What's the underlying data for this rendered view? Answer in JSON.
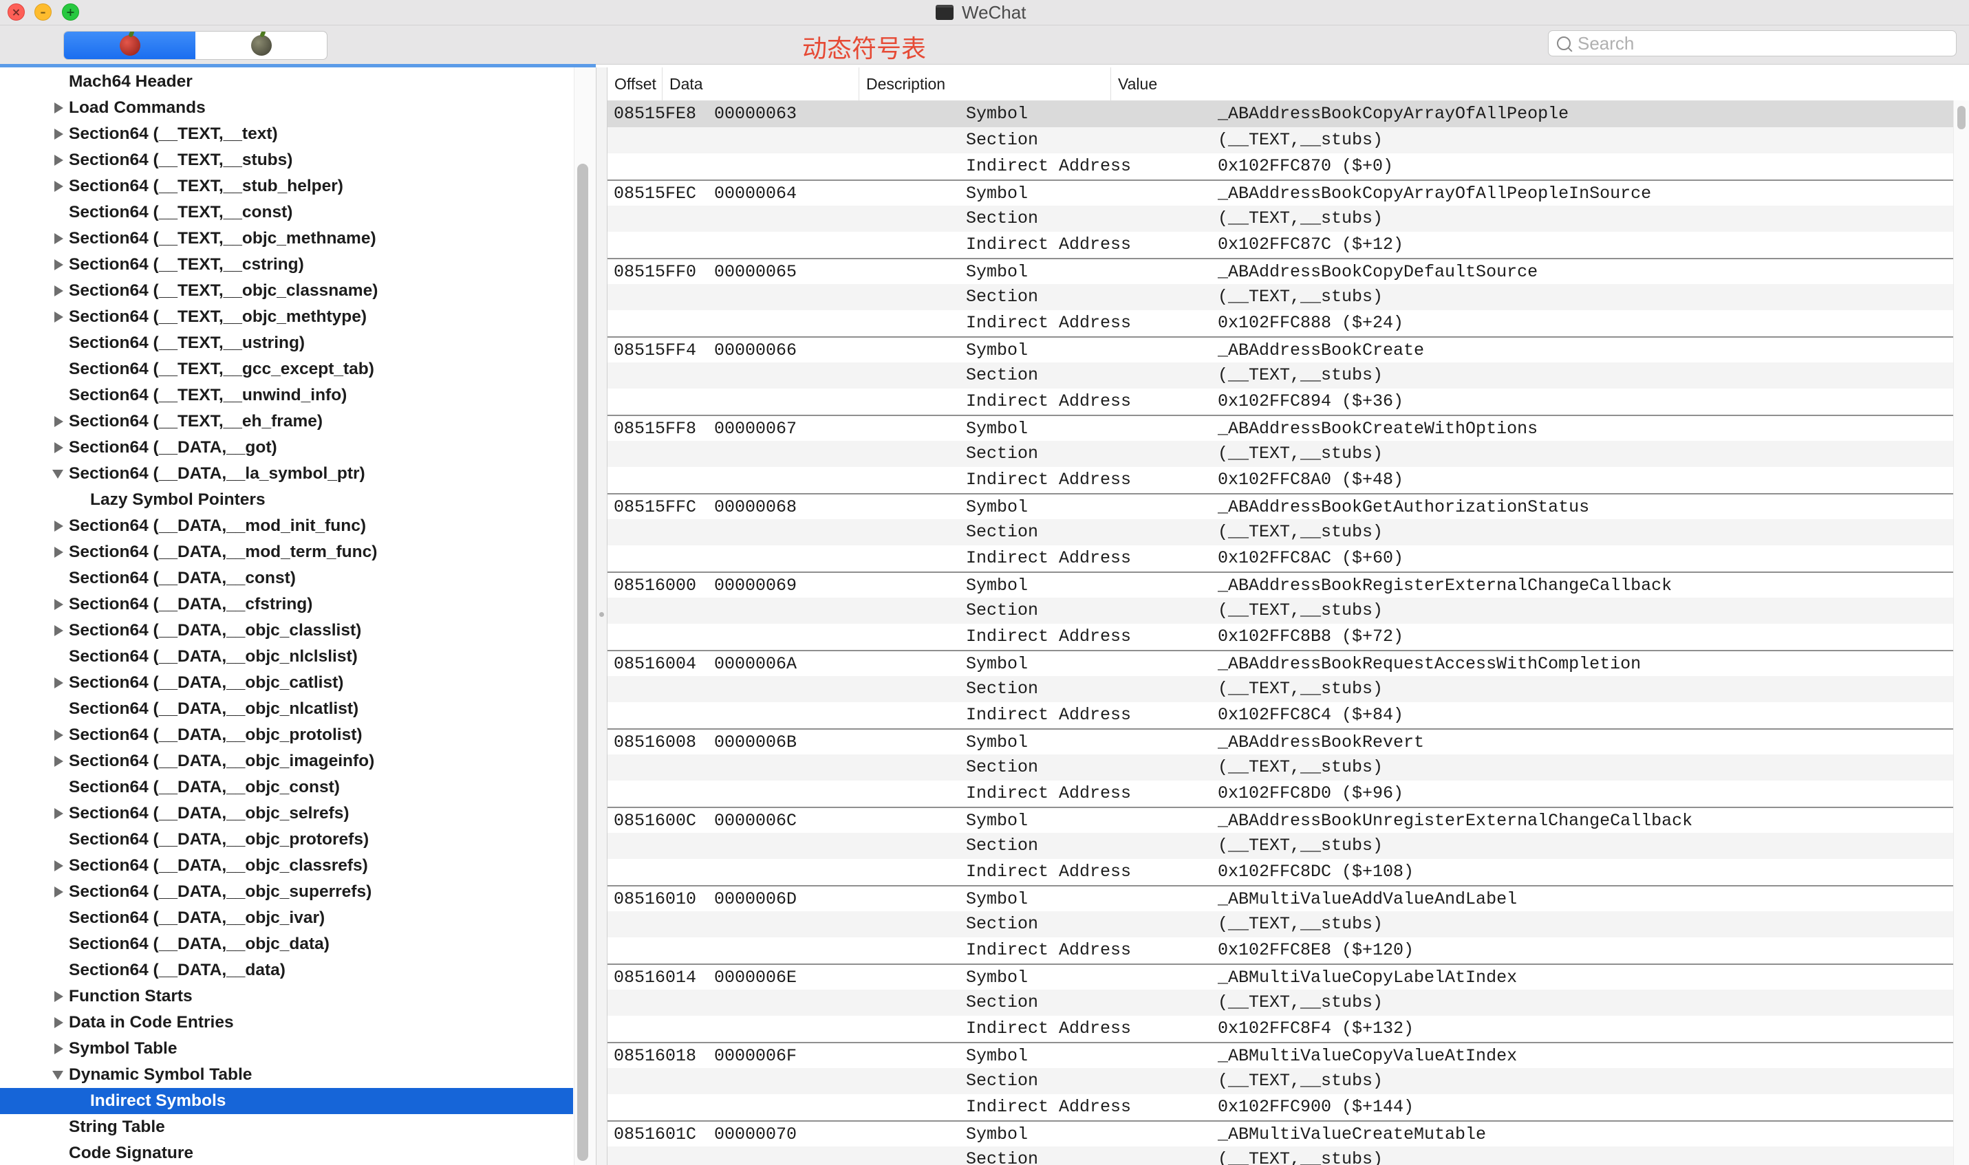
{
  "window": {
    "title": "WeChat"
  },
  "toolbar": {
    "title": "动态符号表",
    "search_placeholder": "Search",
    "search_value": ""
  },
  "sidebar": {
    "items": [
      {
        "label": "Mach64 Header",
        "depth": 0,
        "disclosure": "none"
      },
      {
        "label": "Load Commands",
        "depth": 0,
        "disclosure": "closed"
      },
      {
        "label": "Section64 (__TEXT,__text)",
        "depth": 0,
        "disclosure": "closed"
      },
      {
        "label": "Section64 (__TEXT,__stubs)",
        "depth": 0,
        "disclosure": "closed"
      },
      {
        "label": "Section64 (__TEXT,__stub_helper)",
        "depth": 0,
        "disclosure": "closed"
      },
      {
        "label": "Section64 (__TEXT,__const)",
        "depth": 0,
        "disclosure": "none"
      },
      {
        "label": "Section64 (__TEXT,__objc_methname)",
        "depth": 0,
        "disclosure": "closed"
      },
      {
        "label": "Section64 (__TEXT,__cstring)",
        "depth": 0,
        "disclosure": "closed"
      },
      {
        "label": "Section64 (__TEXT,__objc_classname)",
        "depth": 0,
        "disclosure": "closed"
      },
      {
        "label": "Section64 (__TEXT,__objc_methtype)",
        "depth": 0,
        "disclosure": "closed"
      },
      {
        "label": "Section64 (__TEXT,__ustring)",
        "depth": 0,
        "disclosure": "none"
      },
      {
        "label": "Section64 (__TEXT,__gcc_except_tab)",
        "depth": 0,
        "disclosure": "none"
      },
      {
        "label": "Section64 (__TEXT,__unwind_info)",
        "depth": 0,
        "disclosure": "none"
      },
      {
        "label": "Section64 (__TEXT,__eh_frame)",
        "depth": 0,
        "disclosure": "closed"
      },
      {
        "label": "Section64 (__DATA,__got)",
        "depth": 0,
        "disclosure": "closed"
      },
      {
        "label": "Section64 (__DATA,__la_symbol_ptr)",
        "depth": 0,
        "disclosure": "open"
      },
      {
        "label": "Lazy Symbol Pointers",
        "depth": 1,
        "disclosure": "none"
      },
      {
        "label": "Section64 (__DATA,__mod_init_func)",
        "depth": 0,
        "disclosure": "closed"
      },
      {
        "label": "Section64 (__DATA,__mod_term_func)",
        "depth": 0,
        "disclosure": "closed"
      },
      {
        "label": "Section64 (__DATA,__const)",
        "depth": 0,
        "disclosure": "none"
      },
      {
        "label": "Section64 (__DATA,__cfstring)",
        "depth": 0,
        "disclosure": "closed"
      },
      {
        "label": "Section64 (__DATA,__objc_classlist)",
        "depth": 0,
        "disclosure": "closed"
      },
      {
        "label": "Section64 (__DATA,__objc_nlclslist)",
        "depth": 0,
        "disclosure": "none"
      },
      {
        "label": "Section64 (__DATA,__objc_catlist)",
        "depth": 0,
        "disclosure": "closed"
      },
      {
        "label": "Section64 (__DATA,__objc_nlcatlist)",
        "depth": 0,
        "disclosure": "none"
      },
      {
        "label": "Section64 (__DATA,__objc_protolist)",
        "depth": 0,
        "disclosure": "closed"
      },
      {
        "label": "Section64 (__DATA,__objc_imageinfo)",
        "depth": 0,
        "disclosure": "closed"
      },
      {
        "label": "Section64 (__DATA,__objc_const)",
        "depth": 0,
        "disclosure": "none"
      },
      {
        "label": "Section64 (__DATA,__objc_selrefs)",
        "depth": 0,
        "disclosure": "closed"
      },
      {
        "label": "Section64 (__DATA,__objc_protorefs)",
        "depth": 0,
        "disclosure": "none"
      },
      {
        "label": "Section64 (__DATA,__objc_classrefs)",
        "depth": 0,
        "disclosure": "closed"
      },
      {
        "label": "Section64 (__DATA,__objc_superrefs)",
        "depth": 0,
        "disclosure": "closed"
      },
      {
        "label": "Section64 (__DATA,__objc_ivar)",
        "depth": 0,
        "disclosure": "none"
      },
      {
        "label": "Section64 (__DATA,__objc_data)",
        "depth": 0,
        "disclosure": "none"
      },
      {
        "label": "Section64 (__DATA,__data)",
        "depth": 0,
        "disclosure": "none"
      },
      {
        "label": "Function Starts",
        "depth": 0,
        "disclosure": "closed"
      },
      {
        "label": "Data in Code Entries",
        "depth": 0,
        "disclosure": "closed"
      },
      {
        "label": "Symbol Table",
        "depth": 0,
        "disclosure": "closed"
      },
      {
        "label": "Dynamic Symbol Table",
        "depth": 0,
        "disclosure": "open"
      },
      {
        "label": "Indirect Symbols",
        "depth": 1,
        "disclosure": "none",
        "selected": true
      },
      {
        "label": "String Table",
        "depth": 0,
        "disclosure": "none"
      },
      {
        "label": "Code Signature",
        "depth": 0,
        "disclosure": "none"
      }
    ]
  },
  "table": {
    "columns": [
      "Offset",
      "Data",
      "Description",
      "Value"
    ],
    "groups": [
      {
        "offset": "08515FE8",
        "data": "00000063",
        "symbol": "_ABAddressBookCopyArrayOfAllPeople",
        "section": "(__TEXT,__stubs)",
        "address": "0x102FFC870 ($+0)",
        "selected": true
      },
      {
        "offset": "08515FEC",
        "data": "00000064",
        "symbol": "_ABAddressBookCopyArrayOfAllPeopleInSource",
        "section": "(__TEXT,__stubs)",
        "address": "0x102FFC87C ($+12)"
      },
      {
        "offset": "08515FF0",
        "data": "00000065",
        "symbol": "_ABAddressBookCopyDefaultSource",
        "section": "(__TEXT,__stubs)",
        "address": "0x102FFC888 ($+24)"
      },
      {
        "offset": "08515FF4",
        "data": "00000066",
        "symbol": "_ABAddressBookCreate",
        "section": "(__TEXT,__stubs)",
        "address": "0x102FFC894 ($+36)"
      },
      {
        "offset": "08515FF8",
        "data": "00000067",
        "symbol": "_ABAddressBookCreateWithOptions",
        "section": "(__TEXT,__stubs)",
        "address": "0x102FFC8A0 ($+48)"
      },
      {
        "offset": "08515FFC",
        "data": "00000068",
        "symbol": "_ABAddressBookGetAuthorizationStatus",
        "section": "(__TEXT,__stubs)",
        "address": "0x102FFC8AC ($+60)"
      },
      {
        "offset": "08516000",
        "data": "00000069",
        "symbol": "_ABAddressBookRegisterExternalChangeCallback",
        "section": "(__TEXT,__stubs)",
        "address": "0x102FFC8B8 ($+72)"
      },
      {
        "offset": "08516004",
        "data": "0000006A",
        "symbol": "_ABAddressBookRequestAccessWithCompletion",
        "section": "(__TEXT,__stubs)",
        "address": "0x102FFC8C4 ($+84)"
      },
      {
        "offset": "08516008",
        "data": "0000006B",
        "symbol": "_ABAddressBookRevert",
        "section": "(__TEXT,__stubs)",
        "address": "0x102FFC8D0 ($+96)"
      },
      {
        "offset": "0851600C",
        "data": "0000006C",
        "symbol": "_ABAddressBookUnregisterExternalChangeCallback",
        "section": "(__TEXT,__stubs)",
        "address": "0x102FFC8DC ($+108)"
      },
      {
        "offset": "08516010",
        "data": "0000006D",
        "symbol": "_ABMultiValueAddValueAndLabel",
        "section": "(__TEXT,__stubs)",
        "address": "0x102FFC8E8 ($+120)"
      },
      {
        "offset": "08516014",
        "data": "0000006E",
        "symbol": "_ABMultiValueCopyLabelAtIndex",
        "section": "(__TEXT,__stubs)",
        "address": "0x102FFC8F4 ($+132)"
      },
      {
        "offset": "08516018",
        "data": "0000006F",
        "symbol": "_ABMultiValueCopyValueAtIndex",
        "section": "(__TEXT,__stubs)",
        "address": "0x102FFC900 ($+144)"
      },
      {
        "offset": "0851601C",
        "data": "00000070",
        "symbol": "_ABMultiValueCreateMutable",
        "section": "(__TEXT,__stubs)",
        "address": ""
      }
    ],
    "desc_labels": {
      "symbol": "Symbol",
      "section": "Section",
      "address": "Indirect Address"
    }
  }
}
